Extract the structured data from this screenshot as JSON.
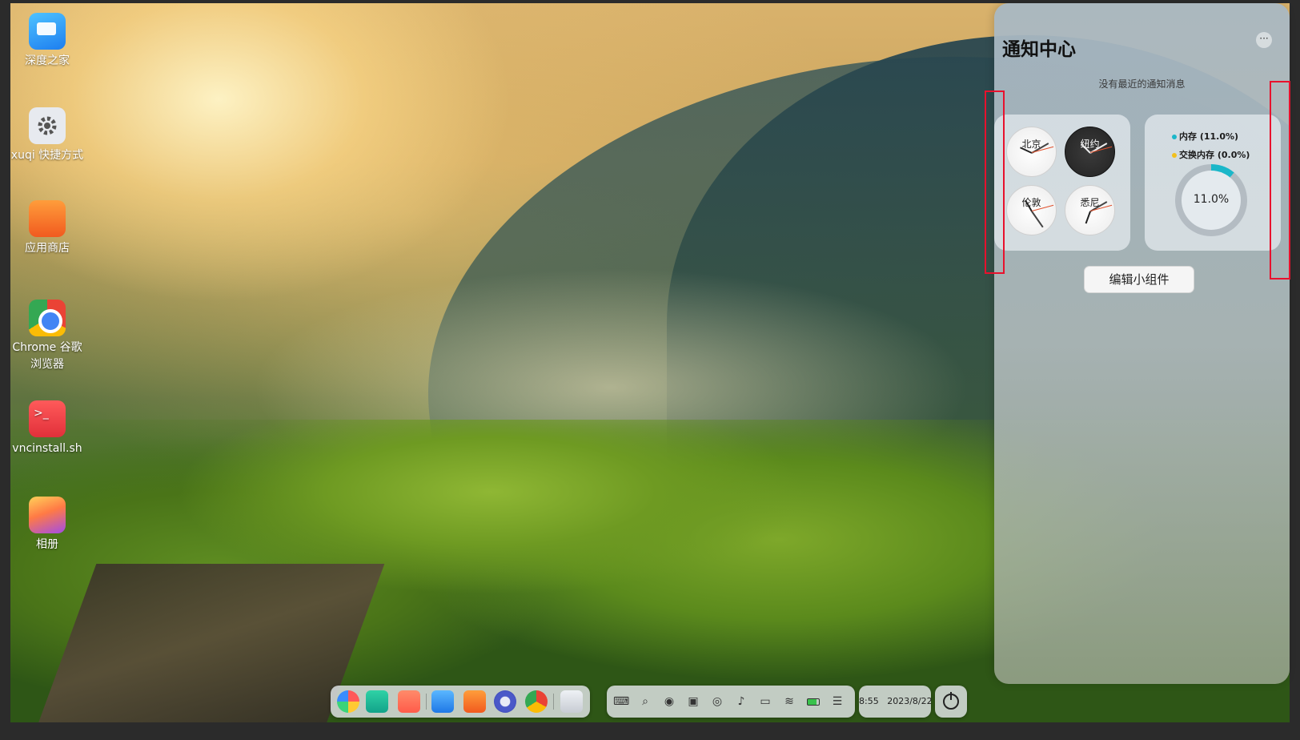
{
  "desktop_icons": [
    {
      "label": "深度之家",
      "icon": "deepin-home-icon"
    },
    {
      "label": "xuqi 快捷方式",
      "icon": "settings-shortcut-icon"
    },
    {
      "label": "应用商店",
      "icon": "app-store-icon"
    },
    {
      "label": "Chrome 谷歌浏览器",
      "icon": "chrome-icon"
    },
    {
      "label": "vncinstall.sh",
      "icon": "shell-script-icon"
    },
    {
      "label": "相册",
      "icon": "album-icon"
    }
  ],
  "notification_center": {
    "title": "通知中心",
    "more_label": "···",
    "empty_text": "没有最近的通知消息",
    "world_clocks": [
      {
        "city": "北京",
        "theme": "light"
      },
      {
        "city": "纽约",
        "theme": "dark"
      },
      {
        "city": "伦敦",
        "theme": "light"
      },
      {
        "city": "悉尼",
        "theme": "light"
      }
    ],
    "memory": {
      "mem_label": "内存 (11.0%)",
      "swap_label": "交换内存 (0.0%)",
      "percent_label": "11.0%",
      "percent": 0.11,
      "mem_color": "#1bb7c9",
      "swap_color": "#f2c01e"
    },
    "edit_widgets_label": "编辑小组件"
  },
  "dock": {
    "apps": [
      "launcher-icon",
      "terminal-icon",
      "multitask-icon",
      "file-manager-icon",
      "app-store-icon",
      "settings-icon",
      "chrome-icon",
      "trash-icon"
    ],
    "tray": [
      "keyboard-icon",
      "search-icon",
      "screen-record-icon",
      "screenshot-icon",
      "broadcast-icon",
      "volume-icon",
      "input-method-icon",
      "wifi-icon",
      "battery-icon",
      "control-center-icon"
    ],
    "time": "8:55",
    "date": "2023/8/22"
  }
}
